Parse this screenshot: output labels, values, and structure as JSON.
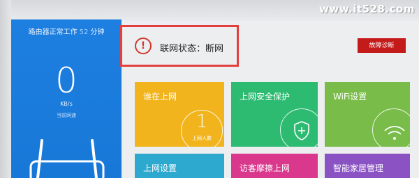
{
  "watermark": "www.it528.com",
  "status_panel": {
    "uptime_prefix": "路由器正常工作",
    "uptime_value": "52",
    "uptime_unit": "分钟",
    "speed_value": "0",
    "speed_unit": "KB/s",
    "speed_label": "当前网速"
  },
  "connection": {
    "icon": "!",
    "label": "联网状态：断网"
  },
  "diagnose_button": "故障诊断",
  "tiles": [
    {
      "title": "谁在上网",
      "count": "1",
      "count_label": "上网人数",
      "color": "#f1b41c"
    },
    {
      "title": "上网安全保护",
      "icon": "shield-plus-icon",
      "color": "#2dbb72"
    },
    {
      "title": "WiFi设置",
      "icon": "wifi-icon",
      "color": "#79bc49"
    },
    {
      "title": "上网设置",
      "color": "#2da8cf"
    },
    {
      "title": "访客摩擦上网",
      "color": "#d9388d"
    },
    {
      "title": "智能家居管理",
      "color": "#8b52c4"
    }
  ],
  "colors": {
    "status_panel_blue": "#1d7fe0",
    "diagnose_red": "#c41a1a",
    "highlight_red": "#e43f3f"
  }
}
